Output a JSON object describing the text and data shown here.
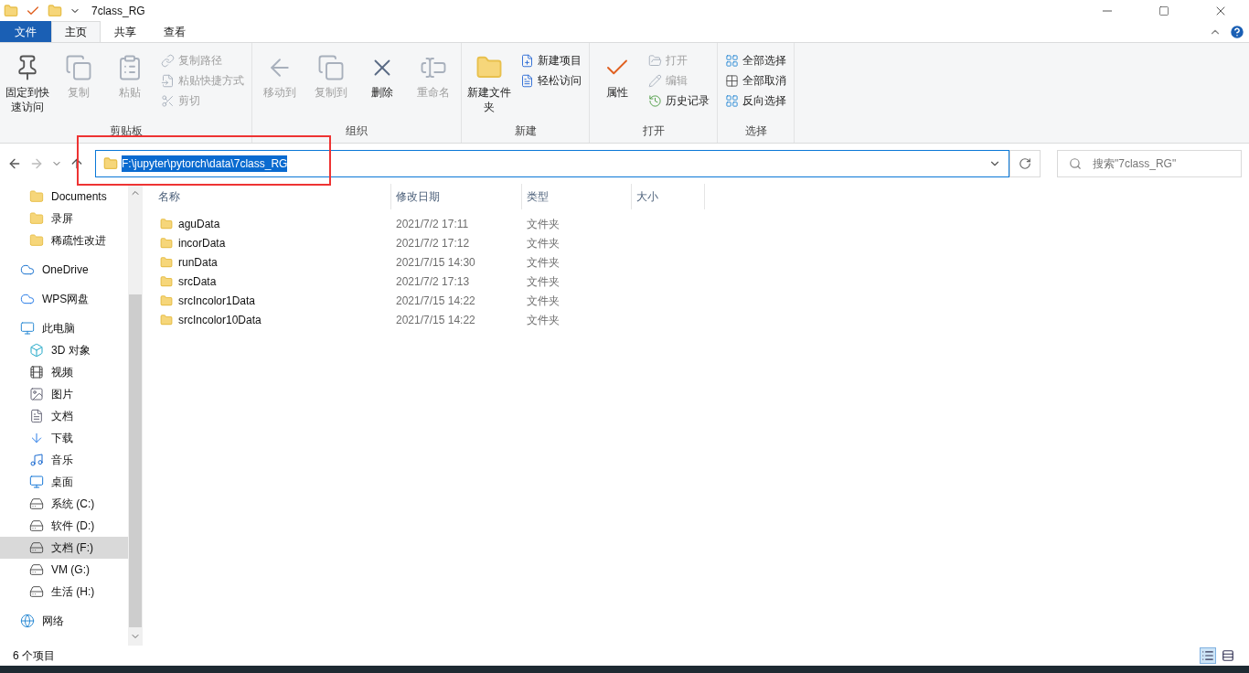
{
  "window": {
    "title": "7class_RG"
  },
  "ribbon_tabs": [
    {
      "label": "文件",
      "kind": "file"
    },
    {
      "label": "主页",
      "kind": "tab",
      "selected": true
    },
    {
      "label": "共享",
      "kind": "tab",
      "selected": false
    },
    {
      "label": "查看",
      "kind": "tab",
      "selected": false
    }
  ],
  "ribbon_groups": [
    {
      "label": "剪贴板",
      "items": [
        {
          "label": "固定到快速访问",
          "kind": "large",
          "disabled": false
        },
        {
          "label": "复制",
          "kind": "large",
          "disabled": true
        },
        {
          "label": "粘贴",
          "kind": "large",
          "disabled": true
        },
        {
          "kind": "column",
          "items": [
            {
              "label": "复制路径",
              "disabled": true
            },
            {
              "label": "粘贴快捷方式",
              "disabled": true
            },
            {
              "label": "剪切",
              "disabled": true
            }
          ]
        }
      ]
    },
    {
      "label": "组织",
      "items": [
        {
          "label": "移动到",
          "kind": "large",
          "disabled": true
        },
        {
          "label": "复制到",
          "kind": "large",
          "disabled": true
        },
        {
          "label": "删除",
          "kind": "large",
          "disabled": false
        },
        {
          "label": "重命名",
          "kind": "large",
          "disabled": true
        }
      ]
    },
    {
      "label": "新建",
      "items": [
        {
          "label": "新建文件夹",
          "kind": "large",
          "disabled": false
        },
        {
          "kind": "column",
          "items": [
            {
              "label": "新建项目",
              "disabled": false
            },
            {
              "label": "轻松访问",
              "disabled": false
            }
          ]
        }
      ]
    },
    {
      "label": "打开",
      "items": [
        {
          "label": "属性",
          "kind": "large",
          "disabled": false
        },
        {
          "kind": "column",
          "items": [
            {
              "label": "打开",
              "disabled": true
            },
            {
              "label": "编辑",
              "disabled": true
            },
            {
              "label": "历史记录",
              "disabled": false
            }
          ]
        }
      ]
    },
    {
      "label": "选择",
      "items": [
        {
          "kind": "column",
          "items": [
            {
              "label": "全部选择",
              "disabled": false
            },
            {
              "label": "全部取消",
              "disabled": false
            },
            {
              "label": "反向选择",
              "disabled": false
            }
          ]
        }
      ]
    }
  ],
  "address_bar": {
    "path": "F:\\jupyter\\pytorch\\data\\7class_RG",
    "selected": true
  },
  "search": {
    "placeholder": "搜索\"7class_RG\""
  },
  "sidebar": {
    "items": [
      {
        "label": "Documents",
        "kind": "folder",
        "selected": false
      },
      {
        "label": "录屏",
        "kind": "folder",
        "selected": false
      },
      {
        "label": "稀疏性改进",
        "kind": "folder",
        "selected": false
      },
      {
        "label": "OneDrive",
        "kind": "cloud",
        "selected": false
      },
      {
        "label": "WPS网盘",
        "kind": "wps",
        "selected": false
      },
      {
        "label": "此电脑",
        "kind": "pc",
        "selected": false,
        "children": [
          {
            "label": "3D 对象",
            "kind": "cube",
            "selected": false
          },
          {
            "label": "视频",
            "kind": "video",
            "selected": false
          },
          {
            "label": "图片",
            "kind": "image",
            "selected": false
          },
          {
            "label": "文档",
            "kind": "doc",
            "selected": false
          },
          {
            "label": "下载",
            "kind": "download",
            "selected": false
          },
          {
            "label": "音乐",
            "kind": "music",
            "selected": false
          },
          {
            "label": "桌面",
            "kind": "desktop",
            "selected": false
          },
          {
            "label": "系统 (C:)",
            "kind": "sysdrive",
            "selected": false
          },
          {
            "label": "软件 (D:)",
            "kind": "drive",
            "selected": false
          },
          {
            "label": "文档 (F:)",
            "kind": "drive",
            "selected": true
          },
          {
            "label": "VM (G:)",
            "kind": "drive",
            "selected": false
          },
          {
            "label": "生活 (H:)",
            "kind": "drive",
            "selected": false
          }
        ]
      },
      {
        "label": "网络",
        "kind": "network",
        "selected": false
      }
    ]
  },
  "table": {
    "columns": [
      "名称",
      "修改日期",
      "类型",
      "大小"
    ],
    "rows": [
      {
        "name": "aguData",
        "modified": "2021/7/2 17:11",
        "type": "文件夹"
      },
      {
        "name": "incorData",
        "modified": "2021/7/2 17:12",
        "type": "文件夹"
      },
      {
        "name": "runData",
        "modified": "2021/7/15 14:30",
        "type": "文件夹"
      },
      {
        "name": "srcData",
        "modified": "2021/7/2 17:13",
        "type": "文件夹"
      },
      {
        "name": "srcIncolor1Data",
        "modified": "2021/7/15 14:22",
        "type": "文件夹"
      },
      {
        "name": "srcIncolor10Data",
        "modified": "2021/7/15 14:22",
        "type": "文件夹"
      }
    ]
  },
  "status_bar": {
    "item_count": "6 个项目"
  }
}
